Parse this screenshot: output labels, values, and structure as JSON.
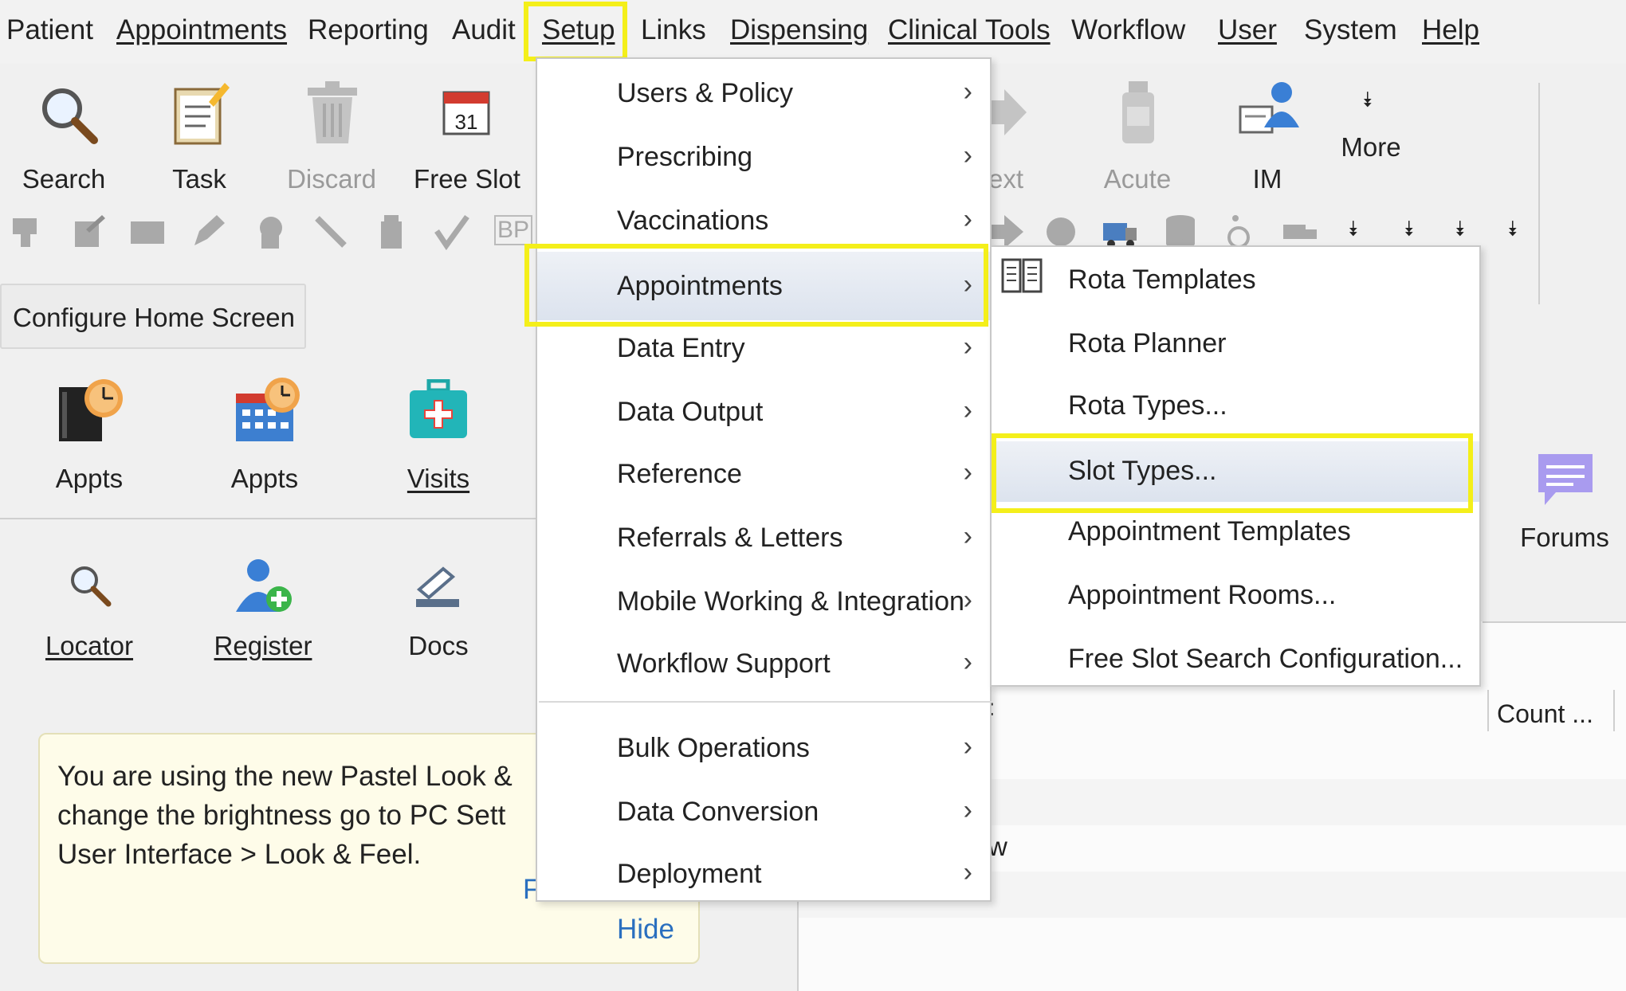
{
  "menubar": {
    "items": [
      "Patient",
      "Appointments",
      "Reporting",
      "Audit",
      "Setup",
      "Links",
      "Dispensing",
      "Clinical Tools",
      "Workflow",
      "User",
      "System",
      "Help"
    ]
  },
  "toolbar": {
    "search": "Search",
    "task": "Task",
    "discard": "Discard",
    "free_slot": "Free Slot",
    "next_partial": "ext",
    "acute": "Acute",
    "im": "IM",
    "more": "More",
    "bp_partial": "BP",
    "calendar_day": "31"
  },
  "configure_home_screen": "Configure Home Screen",
  "home_tiles": {
    "appts1": "Appts",
    "appts2": "Appts",
    "visits": "Visits",
    "locator": "Locator",
    "register": "Register",
    "docs": "Docs",
    "forums": "Forums"
  },
  "notice": {
    "line1": "You are using the new Pastel Look &",
    "line2": "change the brightness go to PC Sett",
    "line3": "User Interface > Look & Feel.",
    "partial": "F",
    "hide": "Hide"
  },
  "right_panel": {
    "count_header": "Count ...",
    "w_partial": "w",
    "colon_partial": ":"
  },
  "setup_menu": {
    "items": [
      {
        "label": "Users & Policy"
      },
      {
        "label": "Prescribing"
      },
      {
        "label": "Vaccinations"
      },
      {
        "label": "Appointments"
      },
      {
        "label": "Data Entry"
      },
      {
        "label": "Data Output"
      },
      {
        "label": "Reference"
      },
      {
        "label": "Referrals & Letters"
      },
      {
        "label": "Mobile Working & Integration"
      },
      {
        "label": "Workflow Support"
      },
      {
        "label": "Bulk Operations"
      },
      {
        "label": "Data Conversion"
      },
      {
        "label": "Deployment"
      }
    ],
    "arrow": "›"
  },
  "appointments_submenu": {
    "items": [
      {
        "label": "Rota Templates"
      },
      {
        "label": "Rota Planner"
      },
      {
        "label": "Rota Types..."
      },
      {
        "label": "Slot Types..."
      },
      {
        "label": "Appointment Templates"
      },
      {
        "label": "Appointment Rooms..."
      },
      {
        "label": "Free Slot Search Configuration..."
      }
    ]
  },
  "colors": {
    "highlight": "#f4ef1a",
    "link": "#2a6fbf",
    "menu_hover": "#dce3ee"
  }
}
